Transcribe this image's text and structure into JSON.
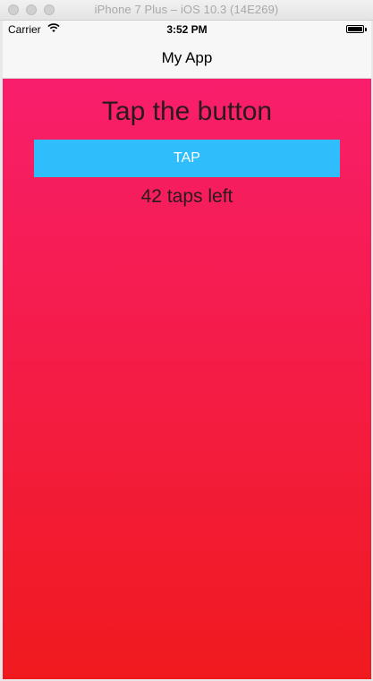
{
  "window": {
    "title": "iPhone 7 Plus – iOS 10.3 (14E269)"
  },
  "status_bar": {
    "carrier": "Carrier",
    "time": "3:52 PM",
    "battery_level": 1.0
  },
  "nav_bar": {
    "title": "My App"
  },
  "main": {
    "heading": "Tap the button",
    "button_label": "TAP",
    "counter_text": "42 taps left"
  },
  "colors": {
    "gradient_top": "#f81e6c",
    "gradient_bottom": "#f01a1e",
    "button": "#2fbdfb",
    "button_text": "#ffffff",
    "text": "#2a1a1e"
  },
  "icons": {
    "wifi": "wifi-icon",
    "battery": "battery-icon"
  }
}
